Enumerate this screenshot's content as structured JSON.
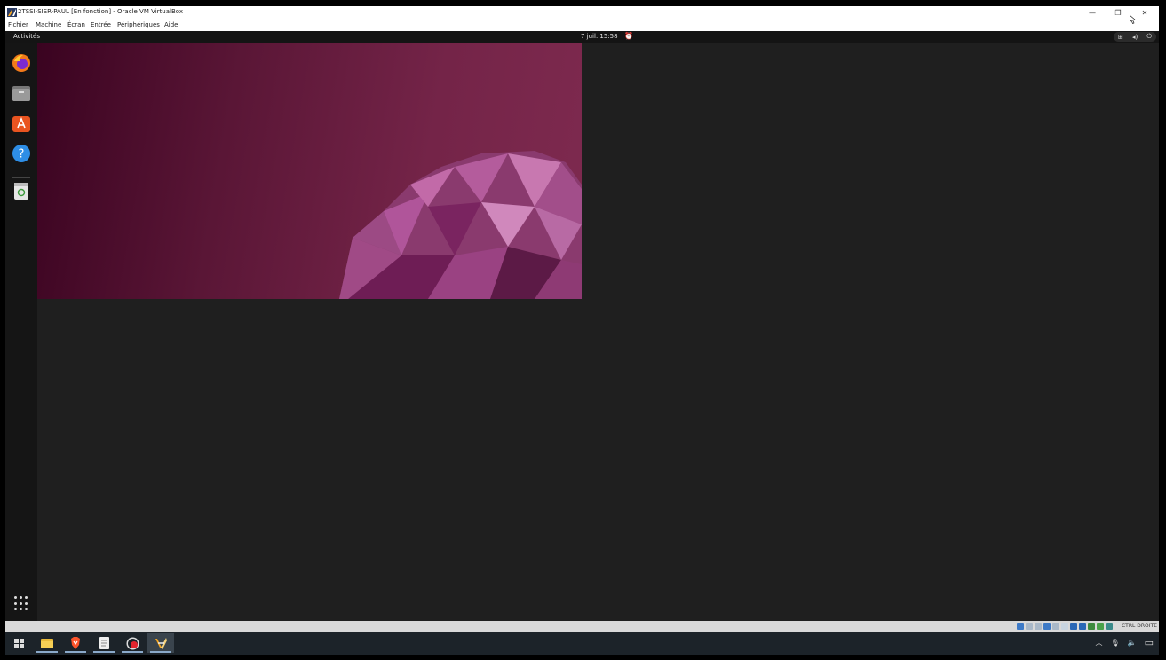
{
  "window": {
    "title": "2TSSI-SISR-PAUL [En fonction] - Oracle VM VirtualBox",
    "controls": {
      "minimize": "—",
      "restore": "❐",
      "close": "✕"
    }
  },
  "menu": {
    "items": [
      "Fichier",
      "Machine",
      "Écran",
      "Entrée",
      "Périphériques",
      "Aide"
    ]
  },
  "ubuntu": {
    "activities": "Activités",
    "clock": "7 juil.  15:58",
    "tray_icons": [
      "network-icon",
      "volume-icon",
      "power-icon"
    ]
  },
  "dock": {
    "apps": [
      "firefox-icon",
      "files-icon",
      "software-center-icon",
      "help-icon",
      "trash-icon"
    ],
    "show_apps": "app-grid-icon"
  },
  "statusbar": {
    "host_key": "CTRL DROITE"
  },
  "taskbar": {
    "items": [
      "windows-start-icon",
      "file-explorer-icon",
      "brave-icon",
      "notepad-icon",
      "recorder-icon",
      "virtualbox-icon"
    ],
    "tray": [
      "chevron-up-icon",
      "microphone-icon",
      "speaker-icon",
      "notifications-icon"
    ]
  },
  "colors": {
    "ubuntu_bg": "#1f1f1f",
    "wallpaper_dark": "#3a0320",
    "wallpaper_light": "#7e2a4f",
    "accent_purple": "#b04c8a"
  }
}
